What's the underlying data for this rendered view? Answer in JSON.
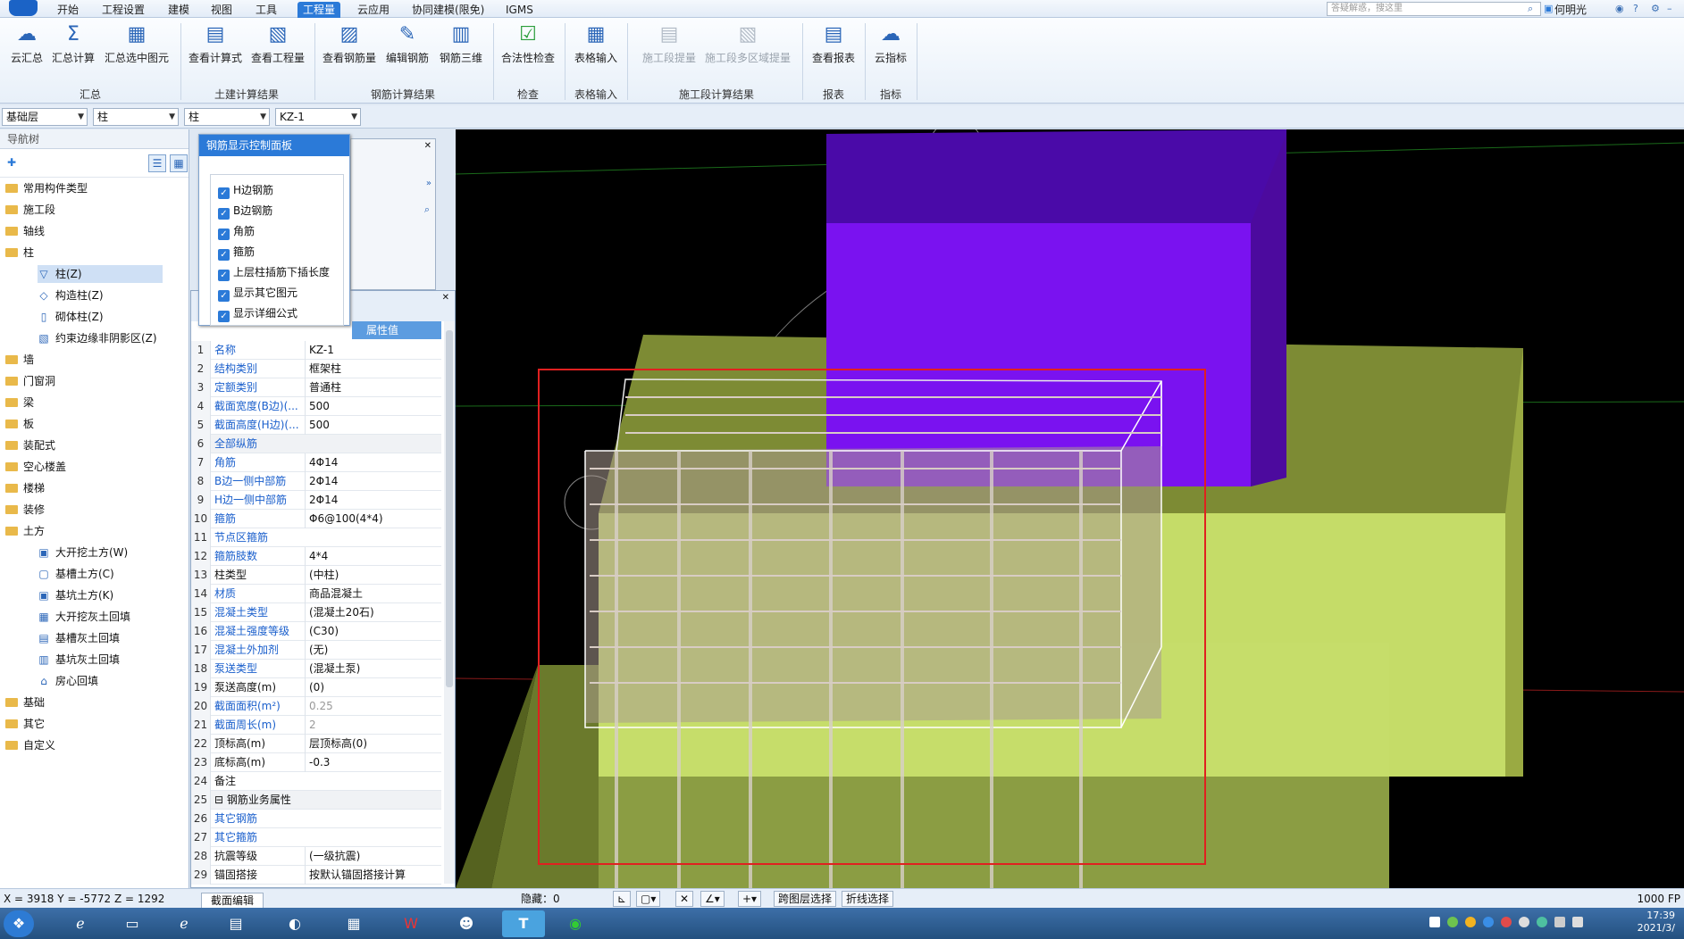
{
  "menu": {
    "tabs": [
      "开始",
      "工程设置",
      "建模",
      "视图",
      "工具",
      "工程量",
      "云应用",
      "协同建模(限免)",
      "IGMS"
    ],
    "active_index": 5
  },
  "search": {
    "placeholder": "答疑解惑，搜这里"
  },
  "user": {
    "name": "何明光"
  },
  "ribbon": {
    "buttons": [
      "云汇总",
      "汇总计算",
      "汇总选中图元",
      "查看计算式",
      "查看工程量",
      "查看钢筋量",
      "编辑钢筋",
      "钢筋三维",
      "合法性检查",
      "表格输入",
      "施工段提量",
      "施工段多区域提量",
      "查看报表",
      "云指标"
    ],
    "groups": [
      "汇总",
      "土建计算结果",
      "钢筋计算结果",
      "检查",
      "表格输入",
      "施工段计算结果",
      "报表",
      "指标"
    ]
  },
  "selectors": [
    "基础层",
    "柱",
    "柱",
    "KZ-1"
  ],
  "nav": {
    "title": "导航树",
    "items": [
      {
        "label": "常用构件类型",
        "kind": "folder"
      },
      {
        "label": "施工段",
        "kind": "folder"
      },
      {
        "label": "轴线",
        "kind": "folder"
      },
      {
        "label": "柱",
        "kind": "folder-open"
      },
      {
        "label": "柱(Z)",
        "kind": "child",
        "selected": true
      },
      {
        "label": "构造柱(Z)",
        "kind": "child"
      },
      {
        "label": "砌体柱(Z)",
        "kind": "child"
      },
      {
        "label": "约束边缘非阴影区(Z)",
        "kind": "child"
      },
      {
        "label": "墙",
        "kind": "folder"
      },
      {
        "label": "门窗洞",
        "kind": "folder"
      },
      {
        "label": "梁",
        "kind": "folder"
      },
      {
        "label": "板",
        "kind": "folder"
      },
      {
        "label": "装配式",
        "kind": "folder"
      },
      {
        "label": "空心楼盖",
        "kind": "folder"
      },
      {
        "label": "楼梯",
        "kind": "folder"
      },
      {
        "label": "装修",
        "kind": "folder"
      },
      {
        "label": "土方",
        "kind": "folder-open"
      },
      {
        "label": "大开挖土方(W)",
        "kind": "child"
      },
      {
        "label": "基槽土方(C)",
        "kind": "child"
      },
      {
        "label": "基坑土方(K)",
        "kind": "child"
      },
      {
        "label": "大开挖灰土回填",
        "kind": "child"
      },
      {
        "label": "基槽灰土回填",
        "kind": "child"
      },
      {
        "label": "基坑灰土回填",
        "kind": "child"
      },
      {
        "label": "房心回填",
        "kind": "child"
      },
      {
        "label": "基础",
        "kind": "folder"
      },
      {
        "label": "其它",
        "kind": "folder"
      },
      {
        "label": "自定义",
        "kind": "folder"
      }
    ]
  },
  "rebar_panel": {
    "title": "钢筋显示控制面板",
    "options": [
      "H边钢筋",
      "B边钢筋",
      "角筋",
      "箍筋",
      "上层柱插筋下插长度",
      "显示其它图元",
      "显示详细公式"
    ]
  },
  "props": {
    "column_header": "属性值",
    "rows": [
      {
        "n": "1",
        "k": "名称",
        "v": "KZ-1",
        "blue": true
      },
      {
        "n": "2",
        "k": "结构类别",
        "v": "框架柱",
        "blue": true
      },
      {
        "n": "3",
        "k": "定额类别",
        "v": "普通柱",
        "blue": true
      },
      {
        "n": "4",
        "k": "截面宽度(B边)(...",
        "v": "500",
        "blue": true
      },
      {
        "n": "5",
        "k": "截面高度(H边)(...",
        "v": "500",
        "blue": true
      },
      {
        "n": "6",
        "k": "全部纵筋",
        "v": "",
        "blue": true
      },
      {
        "n": "7",
        "k": "角筋",
        "v": "4Φ14",
        "blue": true
      },
      {
        "n": "8",
        "k": "B边一侧中部筋",
        "v": "2Φ14",
        "blue": true
      },
      {
        "n": "9",
        "k": "H边一侧中部筋",
        "v": "2Φ14",
        "blue": true
      },
      {
        "n": "10",
        "k": "箍筋",
        "v": "Φ6@100(4*4)",
        "blue": true
      },
      {
        "n": "11",
        "k": "节点区箍筋",
        "v": "",
        "blue": true
      },
      {
        "n": "12",
        "k": "箍筋肢数",
        "v": "4*4",
        "blue": true
      },
      {
        "n": "13",
        "k": "柱类型",
        "v": "(中柱)",
        "blue": false
      },
      {
        "n": "14",
        "k": "材质",
        "v": "商品混凝土",
        "blue": true
      },
      {
        "n": "15",
        "k": "混凝土类型",
        "v": "(混凝土20石)",
        "blue": true
      },
      {
        "n": "16",
        "k": "混凝土强度等级",
        "v": "(C30)",
        "blue": true
      },
      {
        "n": "17",
        "k": "混凝土外加剂",
        "v": "(无)",
        "blue": true
      },
      {
        "n": "18",
        "k": "泵送类型",
        "v": "(混凝土泵)",
        "blue": true
      },
      {
        "n": "19",
        "k": "泵送高度(m)",
        "v": "(0)",
        "blue": false
      },
      {
        "n": "20",
        "k": "截面面积(m²)",
        "v": "0.25",
        "blue": true,
        "grey": true
      },
      {
        "n": "21",
        "k": "截面周长(m)",
        "v": "2",
        "blue": true,
        "grey": true
      },
      {
        "n": "22",
        "k": "顶标高(m)",
        "v": "层顶标高(0)",
        "blue": false
      },
      {
        "n": "23",
        "k": "底标高(m)",
        "v": "-0.3",
        "blue": false
      },
      {
        "n": "24",
        "k": "备注",
        "v": "",
        "blue": false
      },
      {
        "n": "25",
        "k": "⊟ 钢筋业务属性",
        "v": "",
        "blue": false
      },
      {
        "n": "26",
        "k": "    其它钢筋",
        "v": "",
        "blue": true
      },
      {
        "n": "27",
        "k": "    其它箍筋",
        "v": "",
        "blue": true
      },
      {
        "n": "28",
        "k": "    抗震等级",
        "v": "(一级抗震)",
        "blue": false
      },
      {
        "n": "29",
        "k": "    锚固搭接",
        "v": "按默认锚固搭接计算",
        "blue": false
      }
    ]
  },
  "status": {
    "coords": "X = 3918 Y = -5772 Z = 1292",
    "hidden": "隐藏：0",
    "btn_cross_layer": "跨图层选择",
    "btn_polyline": "折线选择",
    "fps": "1000 FP",
    "tab_label": "截面编辑"
  },
  "clock": {
    "time": "17:39",
    "date": "2021/3/"
  },
  "colors": {
    "accent": "#2b7ad8",
    "slab_top": "#7a8a3a",
    "slab_face": "#c6de6a",
    "column": "#7a12f0"
  }
}
